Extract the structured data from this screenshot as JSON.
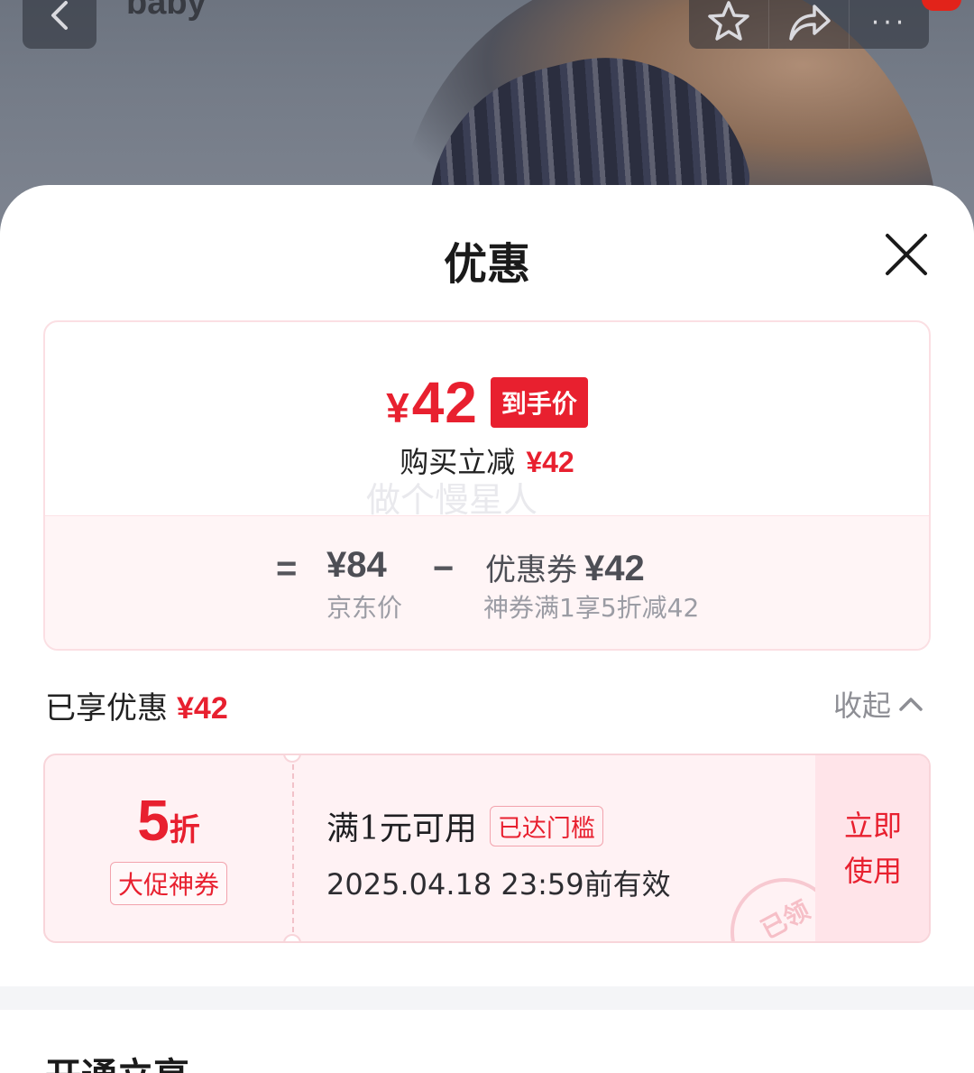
{
  "header": {
    "brand_text": "baby",
    "icons": {
      "back": "back-arrow-icon",
      "favorite": "star-icon",
      "share": "share-icon",
      "more": "more-dots-icon"
    }
  },
  "sheet": {
    "title": "优惠",
    "close_icon": "close-icon"
  },
  "price_summary": {
    "final_price_symbol": "¥",
    "final_price_value": "42",
    "final_price_tag": "到手价",
    "reduction_label": "购买立减",
    "reduction_amount": "¥42",
    "watermark": "做个慢星人",
    "equals": "=",
    "jd_price": "¥84",
    "jd_price_label": "京东价",
    "minus": "−",
    "coupon_label": "优惠券",
    "coupon_amount": "¥42",
    "coupon_desc": "神券满1享5折减42"
  },
  "enjoyed": {
    "label": "已享优惠",
    "amount": "¥42",
    "collapse_label": "收起"
  },
  "coupon": {
    "rate": "5",
    "rate_unit": "折",
    "type_tag": "大促神券",
    "condition": "满1元可用",
    "status_tag": "已达门槛",
    "validity": "2025.04.18 23:59前有效",
    "use_button": "立即使用",
    "stamp": "已领"
  },
  "next_section": {
    "title": "开通立享"
  },
  "colors": {
    "accent": "#e8202f",
    "card_bg": "#fff5f6",
    "coupon_bg": "#fff2f4",
    "muted": "#9b9ca4"
  }
}
